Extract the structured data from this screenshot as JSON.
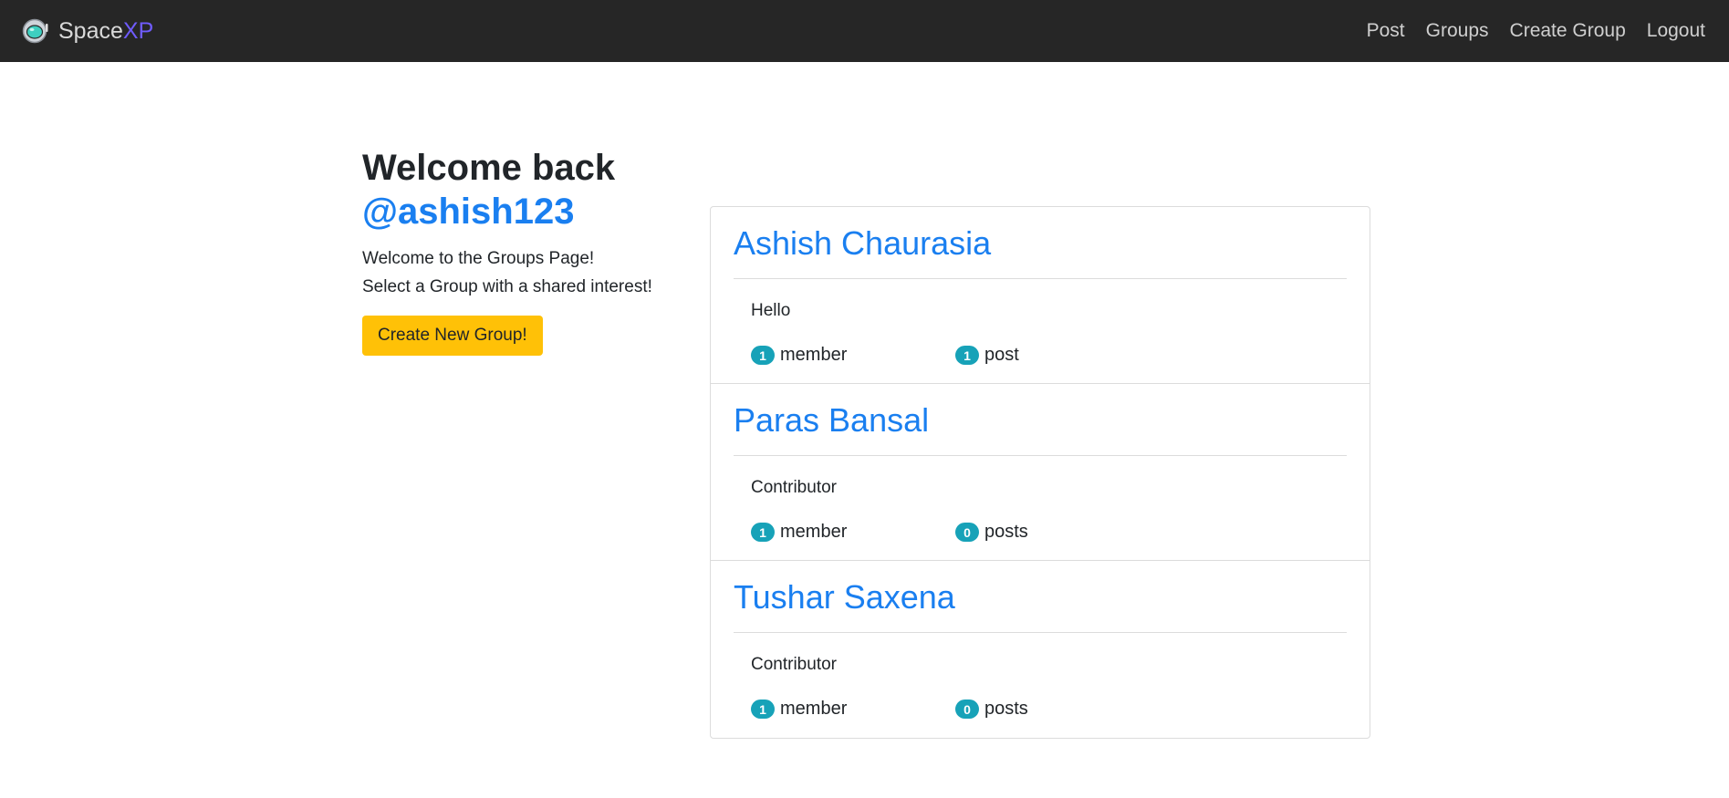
{
  "brand": {
    "name_prefix": "Space",
    "name_suffix": "XP",
    "logo_icon": "astronaut-helmet-icon",
    "suffix_color": "#6f5bff"
  },
  "nav": {
    "items": [
      {
        "label": "Post"
      },
      {
        "label": "Groups"
      },
      {
        "label": "Create Group"
      },
      {
        "label": "Logout"
      }
    ]
  },
  "welcome": {
    "heading": "Welcome back",
    "username": "@ashish123",
    "line1": "Welcome to the Groups Page!",
    "line2": "Select a Group with a shared interest!",
    "create_button": "Create New Group!"
  },
  "groups": [
    {
      "name": "Ashish Chaurasia",
      "description": "Hello",
      "member_count": "1",
      "member_label": "member",
      "post_count": "1",
      "post_label": "post"
    },
    {
      "name": "Paras Bansal",
      "description": "Contributor",
      "member_count": "1",
      "member_label": "member",
      "post_count": "0",
      "post_label": "posts"
    },
    {
      "name": "Tushar Saxena",
      "description": "Contributor",
      "member_count": "1",
      "member_label": "member",
      "post_count": "0",
      "post_label": "posts"
    }
  ],
  "colors": {
    "navbar": "#262626",
    "link": "#1a7ff0",
    "button": "#ffc107",
    "badge": "#17a2b8"
  }
}
